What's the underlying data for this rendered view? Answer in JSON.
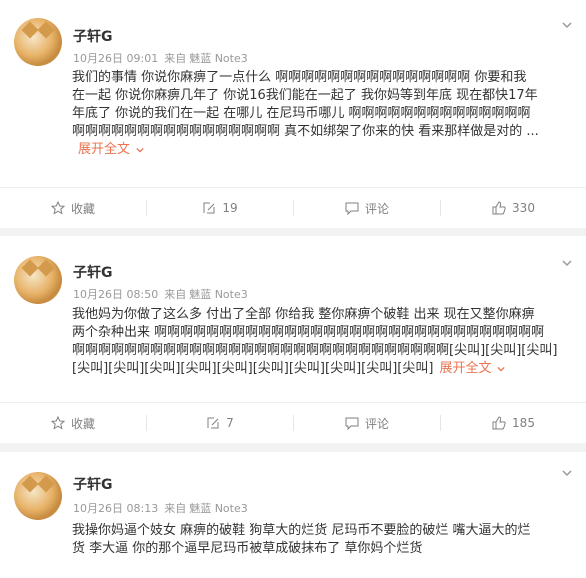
{
  "posts": [
    {
      "username": "子轩G",
      "date": "10月26日 09:01",
      "source_prefix": "来自",
      "source": "魅蓝 Note3",
      "lines": [
        "我们的事情 你说你麻痹了一点什么 啊啊啊啊啊啊啊啊啊啊啊啊啊啊啊 你要和我",
        "在一起 你说你麻痹几年了 你说16我们能在一起了 我你妈等到年底 现在都快17年",
        "年底了 你说的我们在一起 在哪儿 在尼玛币哪儿 啊啊啊啊啊啊啊啊啊啊啊啊啊啊",
        "啊啊啊啊啊啊啊啊啊啊啊啊啊啊啊啊 真不如绑架了你来的快 看来那样做是对的 ..."
      ],
      "expand_label": "展开全文",
      "actions": {
        "favorite": "收藏",
        "repost": "19",
        "comment": "评论",
        "like": "330"
      }
    },
    {
      "username": "子轩G",
      "date": "10月26日 08:50",
      "source_prefix": "来自",
      "source": "魅蓝 Note3",
      "lines": [
        "我他妈为你做了这么多 付出了全部 你给我 整你麻痹个破鞋 出来 现在又整你麻痹",
        "两个杂种出来 啊啊啊啊啊啊啊啊啊啊啊啊啊啊啊啊啊啊啊啊啊啊啊啊啊啊啊啊啊啊",
        "啊啊啊啊啊啊啊啊啊啊啊啊啊啊啊啊啊啊啊啊啊啊啊啊啊啊啊啊啊[尖叫][尖叫][尖叫]",
        "[尖叫][尖叫][尖叫][尖叫][尖叫][尖叫][尖叫][尖叫][尖叫][尖叫]"
      ],
      "expand_label": "展开全文",
      "actions": {
        "favorite": "收藏",
        "repost": "7",
        "comment": "评论",
        "like": "185"
      }
    },
    {
      "username": "子轩G",
      "date": "10月26日 08:13",
      "source_prefix": "来自",
      "source": "魅蓝 Note3",
      "lines": [
        "我操你妈逼个妓女 麻痹的破鞋 狗草大的烂货 尼玛币不要脸的破烂 嘴大逼大的烂",
        "货 李大逼 你的那个逼早尼玛币被草成破抹布了 草你妈个烂货"
      ]
    }
  ],
  "colors": {
    "accent": "#eb7350",
    "text": "#333333",
    "meta": "#999999",
    "background": "#f2f2f2"
  }
}
